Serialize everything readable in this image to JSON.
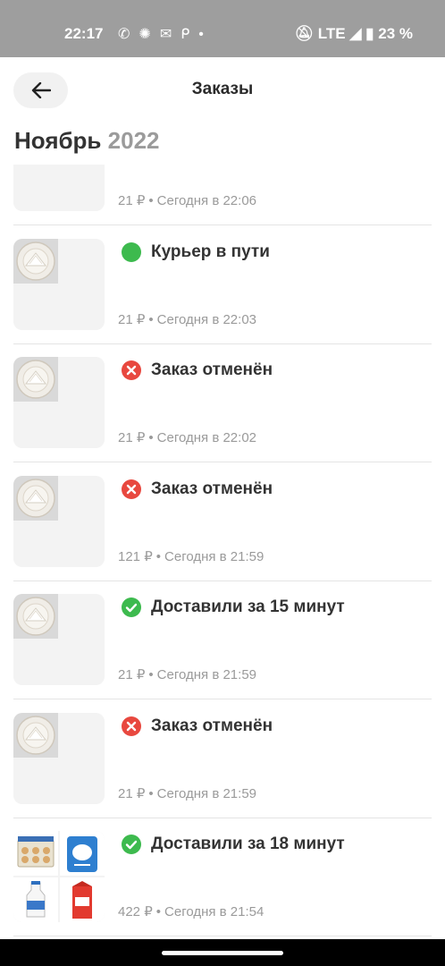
{
  "statusbar": {
    "time": "22:17",
    "icons": [
      "whatsapp-icon",
      "gear-icon",
      "mail-icon",
      "p-icon",
      "dot"
    ],
    "right_text": "LTE ◢ ▮ 23 %",
    "battery": "23 %"
  },
  "header": {
    "title": "Заказы",
    "back_icon": "arrow-left-icon"
  },
  "month": {
    "name": "Ноябрь",
    "year": "2022"
  },
  "orders": [
    {
      "status_text": "",
      "status_type": "none",
      "price": "21 ₽",
      "time": "Сегодня в 22:06",
      "thumb": "plate"
    },
    {
      "status_text": "Курьер в пути",
      "status_type": "on-the-way",
      "price": "21 ₽",
      "time": "Сегодня в 22:03",
      "thumb": "plate"
    },
    {
      "status_text": "Заказ отменён",
      "status_type": "canceled",
      "price": "21 ₽",
      "time": "Сегодня в 22:02",
      "thumb": "plate"
    },
    {
      "status_text": "Заказ отменён",
      "status_type": "canceled",
      "price": "121 ₽",
      "time": "Сегодня в 21:59",
      "thumb": "plate"
    },
    {
      "status_text": "Доставили за 15 минут",
      "status_type": "delivered",
      "price": "21 ₽",
      "time": "Сегодня в 21:59",
      "thumb": "plate"
    },
    {
      "status_text": "Заказ отменён",
      "status_type": "canceled",
      "price": "21 ₽",
      "time": "Сегодня в 21:59",
      "thumb": "plate"
    },
    {
      "status_text": "Доставили за 18 минут",
      "status_type": "delivered",
      "price": "422 ₽",
      "time": "Сегодня в 21:54",
      "thumb": "groceries"
    }
  ],
  "colors": {
    "green": "#3dba4e",
    "red": "#e8483f",
    "text": "#333333",
    "muted": "#9a9a9a"
  }
}
